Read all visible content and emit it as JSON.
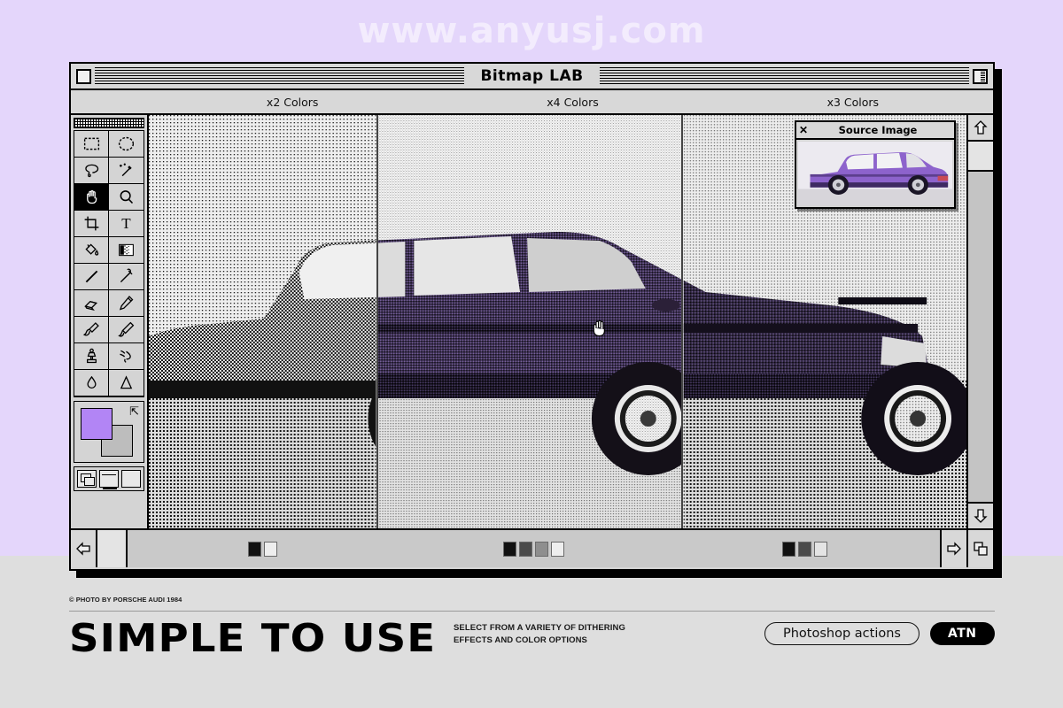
{
  "watermark": "www.anyusj.com",
  "window": {
    "title": "Bitmap LAB",
    "close_button": "close-box",
    "zoom_button": "zoom-box",
    "columns": [
      {
        "label": "x2 Colors"
      },
      {
        "label": "x4 Colors"
      },
      {
        "label": "x3 Colors"
      }
    ]
  },
  "palette": {
    "tools": [
      {
        "name": "marquee-rect-tool",
        "selected": false
      },
      {
        "name": "marquee-ellipse-tool",
        "selected": false
      },
      {
        "name": "lasso-tool",
        "selected": false
      },
      {
        "name": "magic-wand-tool",
        "selected": false
      },
      {
        "name": "hand-tool",
        "selected": true
      },
      {
        "name": "zoom-tool",
        "selected": false
      },
      {
        "name": "crop-tool",
        "selected": false
      },
      {
        "name": "type-tool",
        "selected": false
      },
      {
        "name": "paint-bucket-tool",
        "selected": false
      },
      {
        "name": "gradient-tool",
        "selected": false
      },
      {
        "name": "line-tool",
        "selected": false
      },
      {
        "name": "eyedropper-tool",
        "selected": false
      },
      {
        "name": "eraser-tool",
        "selected": false
      },
      {
        "name": "pencil-tool",
        "selected": false
      },
      {
        "name": "airbrush-tool",
        "selected": false
      },
      {
        "name": "paintbrush-tool",
        "selected": false
      },
      {
        "name": "clone-stamp-tool",
        "selected": false
      },
      {
        "name": "smudge-tool",
        "selected": false
      },
      {
        "name": "blur-tool",
        "selected": false
      },
      {
        "name": "dodge-tool",
        "selected": false
      }
    ],
    "foreground_color": "#b285f5",
    "background_color": "#bdbdbd",
    "swap_icon": "swap-colors-icon",
    "screen_modes": [
      {
        "name": "screen-mode-standard"
      },
      {
        "name": "screen-mode-fullscreen-menubar"
      },
      {
        "name": "screen-mode-fullscreen"
      }
    ]
  },
  "source_window": {
    "title": "Source Image",
    "close_label": "✕"
  },
  "scrollbars": {
    "up_arrow": "scroll-up-arrow",
    "down_arrow": "scroll-down-arrow",
    "left_arrow": "scroll-left-arrow",
    "right_arrow": "scroll-right-arrow",
    "resize_grip": "window-resize-grip"
  },
  "palette_strips": [
    {
      "group": "x2 Colors",
      "colors": [
        "#111111",
        "#eeeeee"
      ]
    },
    {
      "group": "x4 Colors",
      "colors": [
        "#111111",
        "#4a4a4a",
        "#8e8e8e",
        "#eeeeee"
      ]
    },
    {
      "group": "x3 Colors",
      "colors": [
        "#111111",
        "#4a4a4a",
        "#e4e4e4"
      ]
    }
  ],
  "footer": {
    "credit": "© PHOTO BY PORSCHE AUDI 1984",
    "headline": "SIMPLE TO USE",
    "subcopy_line1": "SELECT FROM A VARIETY OF DITHERING",
    "subcopy_line2": "EFFECTS AND COLOR OPTIONS",
    "pill_outline": "Photoshop actions",
    "pill_solid": "ATN"
  },
  "colors": {
    "bg_top": "#e4d6fb",
    "bg_bottom": "#dedede",
    "accent_purple": "#b285f5",
    "chrome": "#d4d4d4",
    "ink": "#000000"
  }
}
